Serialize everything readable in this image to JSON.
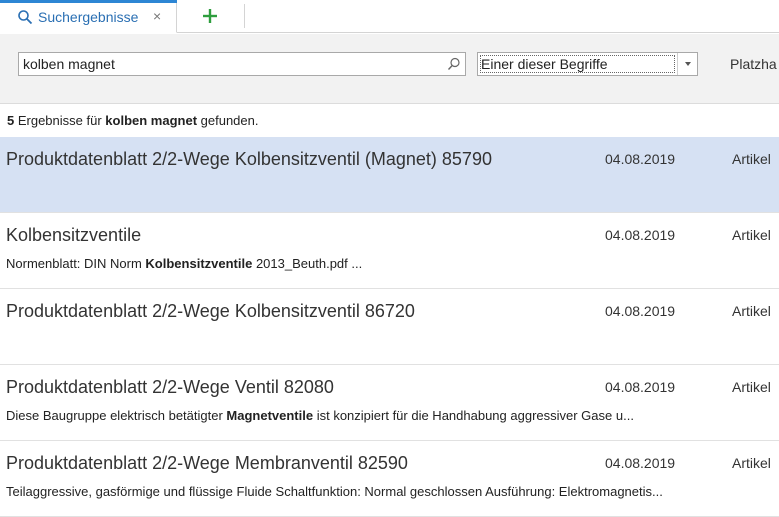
{
  "tabs": [
    {
      "label": "Suchergebnisse",
      "icon": "search-icon",
      "close": "×"
    }
  ],
  "colors": {
    "accent": "#2d86d4",
    "selected_row": "#d6e1f3",
    "add_icon": "#2e9e3e"
  },
  "search": {
    "query": "kolben magnet",
    "mode_selected": "Einer dieser Begriffe",
    "extra_label": "Platzha"
  },
  "summary": {
    "count": "5",
    "text_before": " Ergebnisse für ",
    "term": "kolben magnet",
    "text_after": " gefunden."
  },
  "results": [
    {
      "title": "Produktdatenblatt 2/2-Wege Kolbensitzventil (Magnet) 85790",
      "date": "04.08.2019",
      "type": "Artikel",
      "snippet_before": "",
      "snippet_bold": "",
      "snippet_after": "",
      "selected": true
    },
    {
      "title": "Kolbensitzventile",
      "date": "04.08.2019",
      "type": "Artikel",
      "snippet_before": "Normenblatt: DIN Norm ",
      "snippet_bold": "Kolbensitzventile",
      "snippet_after": " 2013_Beuth.pdf  ...",
      "selected": false
    },
    {
      "title": "Produktdatenblatt 2/2-Wege Kolbensitzventil 86720",
      "date": "04.08.2019",
      "type": "Artikel",
      "snippet_before": "",
      "snippet_bold": "",
      "snippet_after": "",
      "selected": false
    },
    {
      "title": "Produktdatenblatt 2/2-Wege Ventil 82080",
      "date": "04.08.2019",
      "type": "Artikel",
      "snippet_before": "Diese Baugruppe elektrisch betätigter ",
      "snippet_bold": "Magnetventile",
      "snippet_after": " ist konzipiert für die Handhabung aggressiver Gase u...",
      "selected": false
    },
    {
      "title": "Produktdatenblatt 2/2-Wege Membranventil 82590",
      "date": "04.08.2019",
      "type": "Artikel",
      "snippet_before": "Teilaggressive, gasförmige und flüssige Fluide Schaltfunktion: Normal geschlossen Ausführung: Elektromagnetis...",
      "snippet_bold": "",
      "snippet_after": "",
      "selected": false
    }
  ]
}
